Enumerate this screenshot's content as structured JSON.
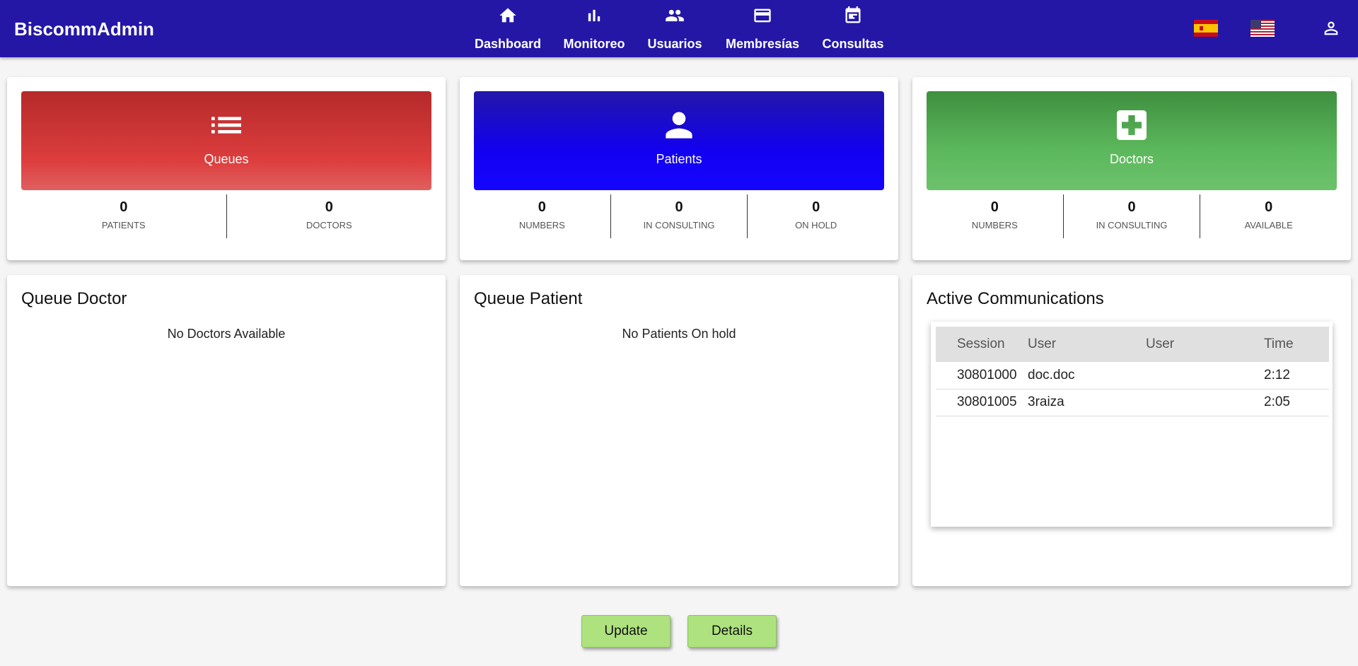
{
  "app": {
    "brand": "BiscommAdmin"
  },
  "nav": [
    {
      "label": "Dashboard",
      "icon": "home-icon"
    },
    {
      "label": "Monitoreo",
      "icon": "bar-chart-icon"
    },
    {
      "label": "Usuarios",
      "icon": "people-icon"
    },
    {
      "label": "Membresías",
      "icon": "credit-card-icon"
    },
    {
      "label": "Consultas",
      "icon": "calendar-icon"
    }
  ],
  "header_right": [
    "spain-flag-icon",
    "usa-flag-icon",
    "user-account-icon"
  ],
  "summary": {
    "queues": {
      "title": "Queues",
      "icon": "list-icon",
      "color": "#d83a3a",
      "stats": [
        {
          "value": "0",
          "label": "PATIENTS"
        },
        {
          "value": "0",
          "label": "DOCTORS"
        }
      ]
    },
    "patients": {
      "title": "Patients",
      "icon": "person-icon",
      "color": "#1505f0",
      "stats": [
        {
          "value": "0",
          "label": "NUMBERS"
        },
        {
          "value": "0",
          "label": "IN CONSULTING"
        },
        {
          "value": "0",
          "label": "ON HOLD"
        }
      ]
    },
    "doctors": {
      "title": "Doctors",
      "icon": "medical-cross-icon",
      "color": "#5cb85c",
      "stats": [
        {
          "value": "0",
          "label": "NUMBERS"
        },
        {
          "value": "0",
          "label": "IN CONSULTING"
        },
        {
          "value": "0",
          "label": "AVAILABLE"
        }
      ]
    }
  },
  "queue_doctor": {
    "title": "Queue Doctor",
    "message": "No Doctors Available"
  },
  "queue_patient": {
    "title": "Queue Patient",
    "message": "No Patients On hold"
  },
  "active_communications": {
    "title": "Active Communications",
    "columns": [
      "Session",
      "User",
      "User",
      "Time"
    ],
    "rows": [
      [
        "30801000",
        "doc.doc",
        "",
        "2:12"
      ],
      [
        "30801005",
        "3raiza",
        "",
        "2:05"
      ]
    ]
  },
  "actions": {
    "update_label": "Update",
    "details_label": "Details",
    "button_color": "#aee27e"
  }
}
